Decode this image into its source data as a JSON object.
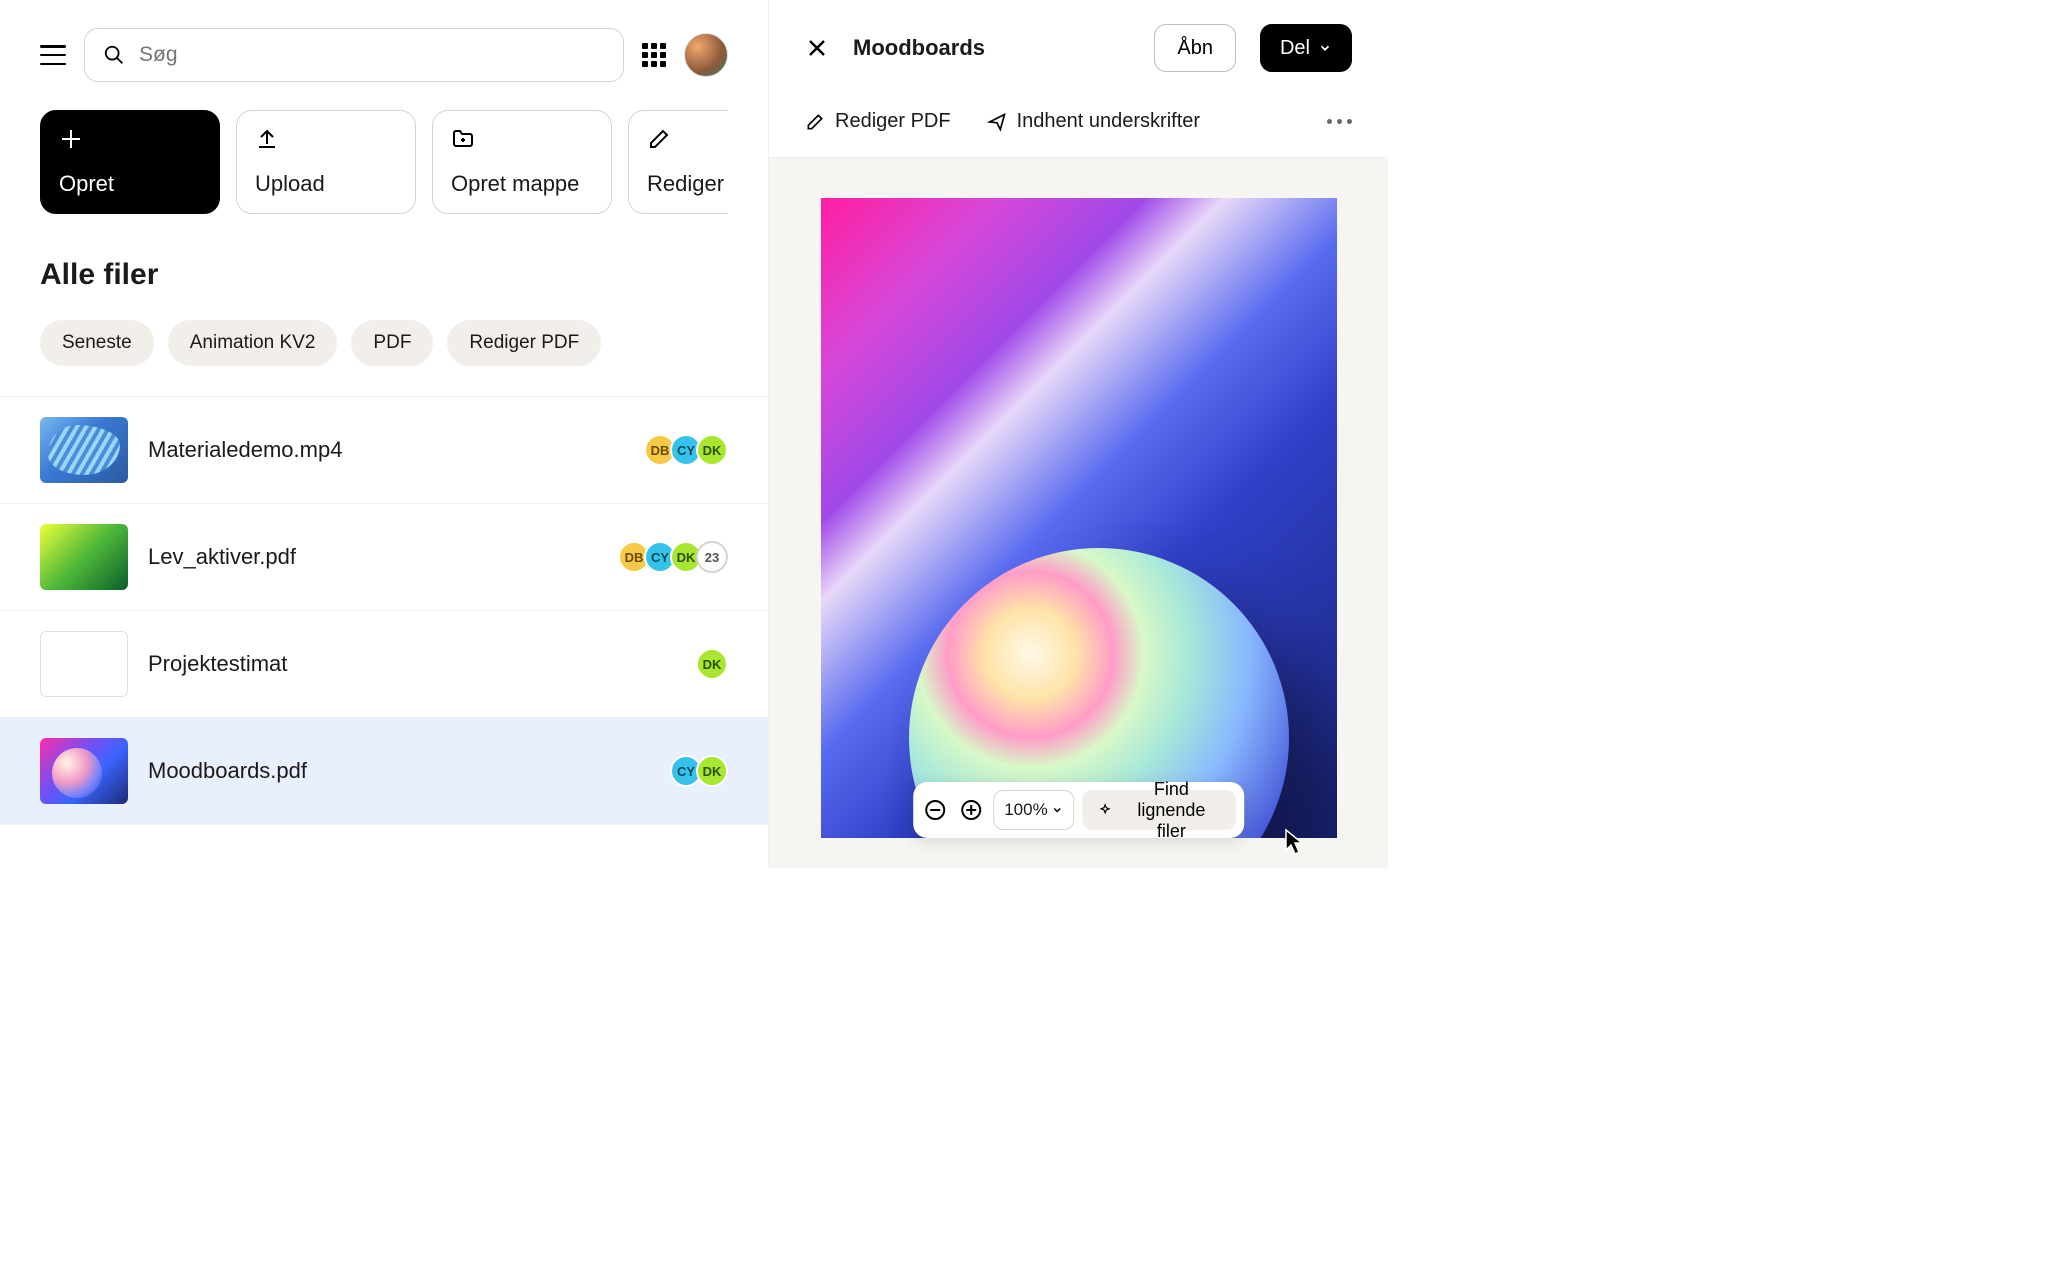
{
  "search": {
    "placeholder": "Søg"
  },
  "actions": [
    {
      "label": "Opret",
      "icon": "plus",
      "primary": true
    },
    {
      "label": "Upload",
      "icon": "upload"
    },
    {
      "label": "Opret mappe",
      "icon": "folder-plus"
    },
    {
      "label": "Rediger PDF",
      "icon": "pencil"
    }
  ],
  "section_title": "Alle filer",
  "chips": [
    "Seneste",
    "Animation KV2",
    "PDF",
    "Rediger PDF"
  ],
  "files": [
    {
      "name": "Materialedemo.mp4",
      "badges": [
        "DB",
        "CY",
        "DK"
      ],
      "overflow": null,
      "thumb": "t1"
    },
    {
      "name": "Lev_aktiver.pdf",
      "badges": [
        "DB",
        "CY",
        "DK"
      ],
      "overflow": "23",
      "thumb": "t2"
    },
    {
      "name": "Projektestimat",
      "badges": [
        "DK"
      ],
      "overflow": null,
      "thumb": "t3"
    },
    {
      "name": "Moodboards.pdf",
      "badges": [
        "CY",
        "DK"
      ],
      "overflow": null,
      "thumb": "t4",
      "selected": true
    }
  ],
  "details": {
    "title": "Moodboards",
    "open_label": "Åbn",
    "share_label": "Del",
    "tools": {
      "edit_pdf": "Rediger PDF",
      "signatures": "Indhent underskrifter"
    },
    "zoom": "100%",
    "find_similar": "Find lignende filer"
  },
  "badge_colors": {
    "DB": "b-orange",
    "CY": "b-blue",
    "DK": "b-green"
  }
}
